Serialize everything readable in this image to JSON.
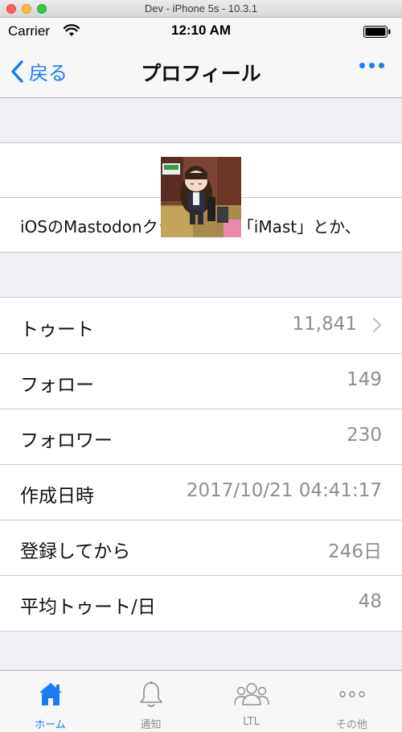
{
  "window": {
    "title": "Dev - iPhone 5s - 10.3.1"
  },
  "status_bar": {
    "carrier": "Carrier",
    "time": "12:10 AM"
  },
  "nav": {
    "back_label": "戻る",
    "title": "プロフィール"
  },
  "profile": {
    "note": "iOSのMastodonクライアント「iMast」とか、"
  },
  "stats": [
    {
      "label": "トゥート",
      "value": "11,841"
    },
    {
      "label": "フォロー",
      "value": "149"
    },
    {
      "label": "フォロワー",
      "value": "230"
    },
    {
      "label": "作成日時",
      "value": "2017/10/21 04:41:17"
    },
    {
      "label": "登録してから",
      "value": "246日"
    },
    {
      "label": "平均トゥート/日",
      "value": "48"
    }
  ],
  "tabs": [
    {
      "label": "ホーム",
      "icon": "home-icon",
      "active": true
    },
    {
      "label": "通知",
      "icon": "bell-icon",
      "active": false
    },
    {
      "label": "LTL",
      "icon": "people-icon",
      "active": false
    },
    {
      "label": "その他",
      "icon": "more-icon",
      "active": false
    }
  ],
  "colors": {
    "accent": "#1a7cf5",
    "secondary_text": "#8e8e93",
    "background": "#efeff4",
    "separator": "#c8c7cc"
  }
}
